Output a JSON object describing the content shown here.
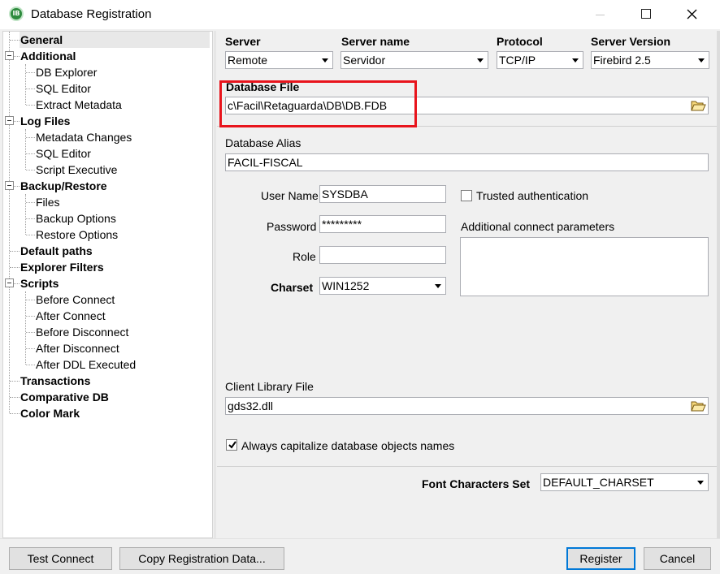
{
  "window": {
    "title": "Database Registration",
    "icon_text": "IB"
  },
  "tree": {
    "items": [
      {
        "label": "General",
        "bold": true,
        "level": 0,
        "selected": true
      },
      {
        "label": "Additional",
        "bold": true,
        "level": 0,
        "expander": true
      },
      {
        "label": "DB Explorer",
        "bold": false,
        "level": 1
      },
      {
        "label": "SQL Editor",
        "bold": false,
        "level": 1
      },
      {
        "label": "Extract Metadata",
        "bold": false,
        "level": 1
      },
      {
        "label": "Log Files",
        "bold": true,
        "level": 0,
        "expander": true
      },
      {
        "label": "Metadata Changes",
        "bold": false,
        "level": 1
      },
      {
        "label": "SQL Editor",
        "bold": false,
        "level": 1
      },
      {
        "label": "Script Executive",
        "bold": false,
        "level": 1
      },
      {
        "label": "Backup/Restore",
        "bold": true,
        "level": 0,
        "expander": true
      },
      {
        "label": "Files",
        "bold": false,
        "level": 1
      },
      {
        "label": "Backup Options",
        "bold": false,
        "level": 1
      },
      {
        "label": "Restore Options",
        "bold": false,
        "level": 1
      },
      {
        "label": "Default paths",
        "bold": true,
        "level": 0
      },
      {
        "label": "Explorer Filters",
        "bold": true,
        "level": 0
      },
      {
        "label": "Scripts",
        "bold": true,
        "level": 0,
        "expander": true
      },
      {
        "label": "Before Connect",
        "bold": false,
        "level": 1
      },
      {
        "label": "After Connect",
        "bold": false,
        "level": 1
      },
      {
        "label": "Before Disconnect",
        "bold": false,
        "level": 1
      },
      {
        "label": "After Disconnect",
        "bold": false,
        "level": 1
      },
      {
        "label": "After DDL Executed",
        "bold": false,
        "level": 1
      },
      {
        "label": "Transactions",
        "bold": true,
        "level": 0
      },
      {
        "label": "Comparative DB",
        "bold": true,
        "level": 0
      },
      {
        "label": "Color Mark",
        "bold": true,
        "level": 0
      }
    ]
  },
  "server": {
    "server_label": "Server",
    "server_value": "Remote",
    "server_name_label": "Server name",
    "server_name_value": "Servidor",
    "protocol_label": "Protocol",
    "protocol_value": "TCP/IP",
    "version_label": "Server Version",
    "version_value": "Firebird 2.5"
  },
  "database": {
    "file_label": "Database File",
    "file_value": "c\\Facil\\Retaguarda\\DB\\DB.FDB",
    "alias_label": "Database Alias",
    "alias_value": "FACIL-FISCAL"
  },
  "credentials": {
    "user_label": "User Name",
    "user_value": "SYSDBA",
    "password_label": "Password",
    "password_value": "*********",
    "role_label": "Role",
    "role_value": "",
    "charset_label": "Charset",
    "charset_value": "WIN1252",
    "trusted_label": "Trusted authentication",
    "trusted_checked": false,
    "params_label": "Additional connect parameters"
  },
  "client": {
    "library_label": "Client Library File",
    "library_value": "gds32.dll",
    "capitalize_label": "Always capitalize database objects names",
    "capitalize_checked": true
  },
  "font": {
    "label": "Font Characters Set",
    "value": "DEFAULT_CHARSET"
  },
  "buttons": {
    "test_connect": "Test Connect",
    "copy_registration": "Copy Registration Data...",
    "register": "Register",
    "cancel": "Cancel"
  },
  "colors": {
    "highlight": "#e8141c",
    "default_button_border": "#0078d7"
  }
}
